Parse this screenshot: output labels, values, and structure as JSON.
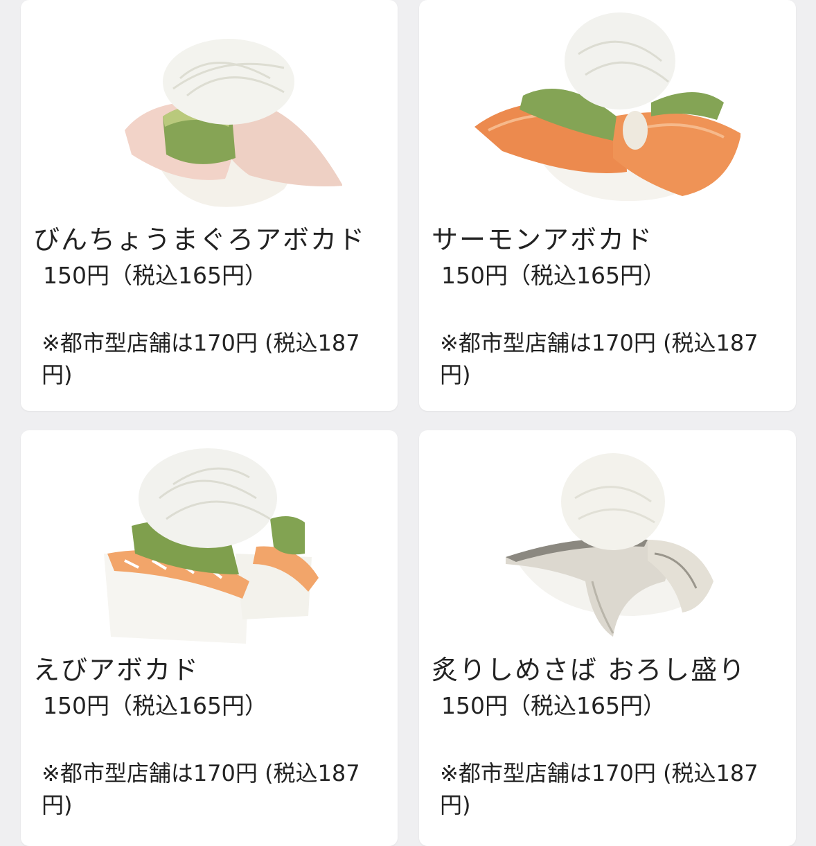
{
  "menu": {
    "items": [
      {
        "name": "びんちょうまぐろアボカド",
        "price": "150円（税込165円）",
        "note": "※都市型店舗は170円 (税込187円)",
        "photo_icon": "sushi-photo-binchou-maguro-avocado"
      },
      {
        "name": "サーモンアボカド",
        "price": "150円（税込165円）",
        "note": "※都市型店舗は170円 (税込187円)",
        "photo_icon": "sushi-photo-salmon-avocado"
      },
      {
        "name": "えびアボカド",
        "price": "150円（税込165円）",
        "note": "※都市型店舗は170円 (税込187円)",
        "photo_icon": "sushi-photo-ebi-avocado"
      },
      {
        "name": "炙りしめさば おろし盛り",
        "price": "150円（税込165円）",
        "note": "※都市型店舗は170円 (税込187円)",
        "photo_icon": "sushi-photo-aburi-shime-saba"
      }
    ]
  },
  "colors": {
    "background": "#efeff1",
    "card": "#ffffff",
    "text": "#222222"
  }
}
